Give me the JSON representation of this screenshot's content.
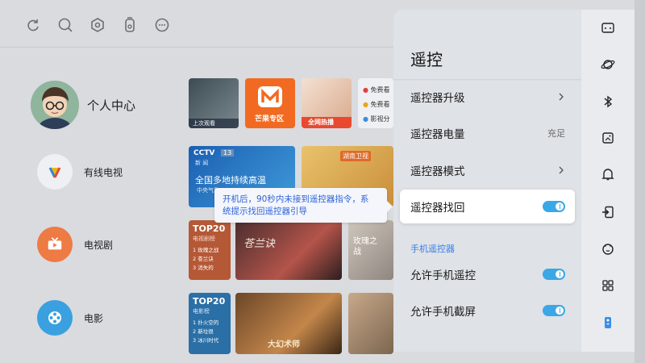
{
  "topbar": {
    "icons": [
      "refresh-icon",
      "search-icon",
      "settings-hex-icon",
      "remote-icon",
      "message-icon"
    ]
  },
  "nav": {
    "items": [
      {
        "label": "个人中心"
      },
      {
        "label": "有线电视"
      },
      {
        "label": "电视剧"
      },
      {
        "label": "电影"
      }
    ]
  },
  "tiles": {
    "recent_caption": "上次观看",
    "mango_caption": "芒果专区",
    "full_caption": "全网热播",
    "list_item_1": "免费看",
    "list_item_2": "免费看",
    "list_item_3": "影视分",
    "cctv_brand": "CCTV",
    "cctv_channel": "13",
    "cctv_sub": "新 闻",
    "cctv_headline": "全国多地持续高温",
    "cctv_footer": "中央气象",
    "hunan_logo": "湖南卫视",
    "tv_top_title": "TOP20",
    "tv_top_sub": "电视剧榜",
    "tv_rank": [
      "1 玫瑰之战",
      "2 苍兰诀",
      "3 消失的"
    ],
    "movie_top_title": "TOP20",
    "movie_top_sub": "电影榜",
    "movie_rank": [
      "1 扑火空的",
      "2 新垃很",
      "3 冰川时代"
    ],
    "drama1_title": "苍兰诀",
    "drama2_title": "玫瑰之战",
    "movie1_title": "大幻术师"
  },
  "tooltip": {
    "line1": "开机后，90秒内未接到遥控器指令，系",
    "line2": "统提示找回遥控器引导"
  },
  "panel": {
    "title": "遥控",
    "rows": [
      {
        "label": "遥控器升级",
        "type": "chevron"
      },
      {
        "label": "遥控器电量",
        "type": "value",
        "value": "充足"
      },
      {
        "label": "遥控器模式",
        "type": "chevron"
      },
      {
        "label": "遥控器找回",
        "type": "toggle",
        "on": true
      }
    ],
    "section_label": "手机遥控器",
    "phone_rows": [
      {
        "label": "允许手机遥控",
        "type": "toggle",
        "on": true
      },
      {
        "label": "允许手机截屏",
        "type": "toggle",
        "on": true
      }
    ]
  },
  "rail": {
    "icons": [
      "picture-mode-icon",
      "planet-icon",
      "bluetooth-icon",
      "image-setting-icon",
      "bell-icon",
      "signal-source-icon",
      "face-icon",
      "apps-grid-icon",
      "remote-control-icon"
    ]
  },
  "colors": {
    "accent": "#3a7ee8",
    "toggle_on": "#3aa7e6",
    "tooltip_text": "#2f64d8"
  }
}
